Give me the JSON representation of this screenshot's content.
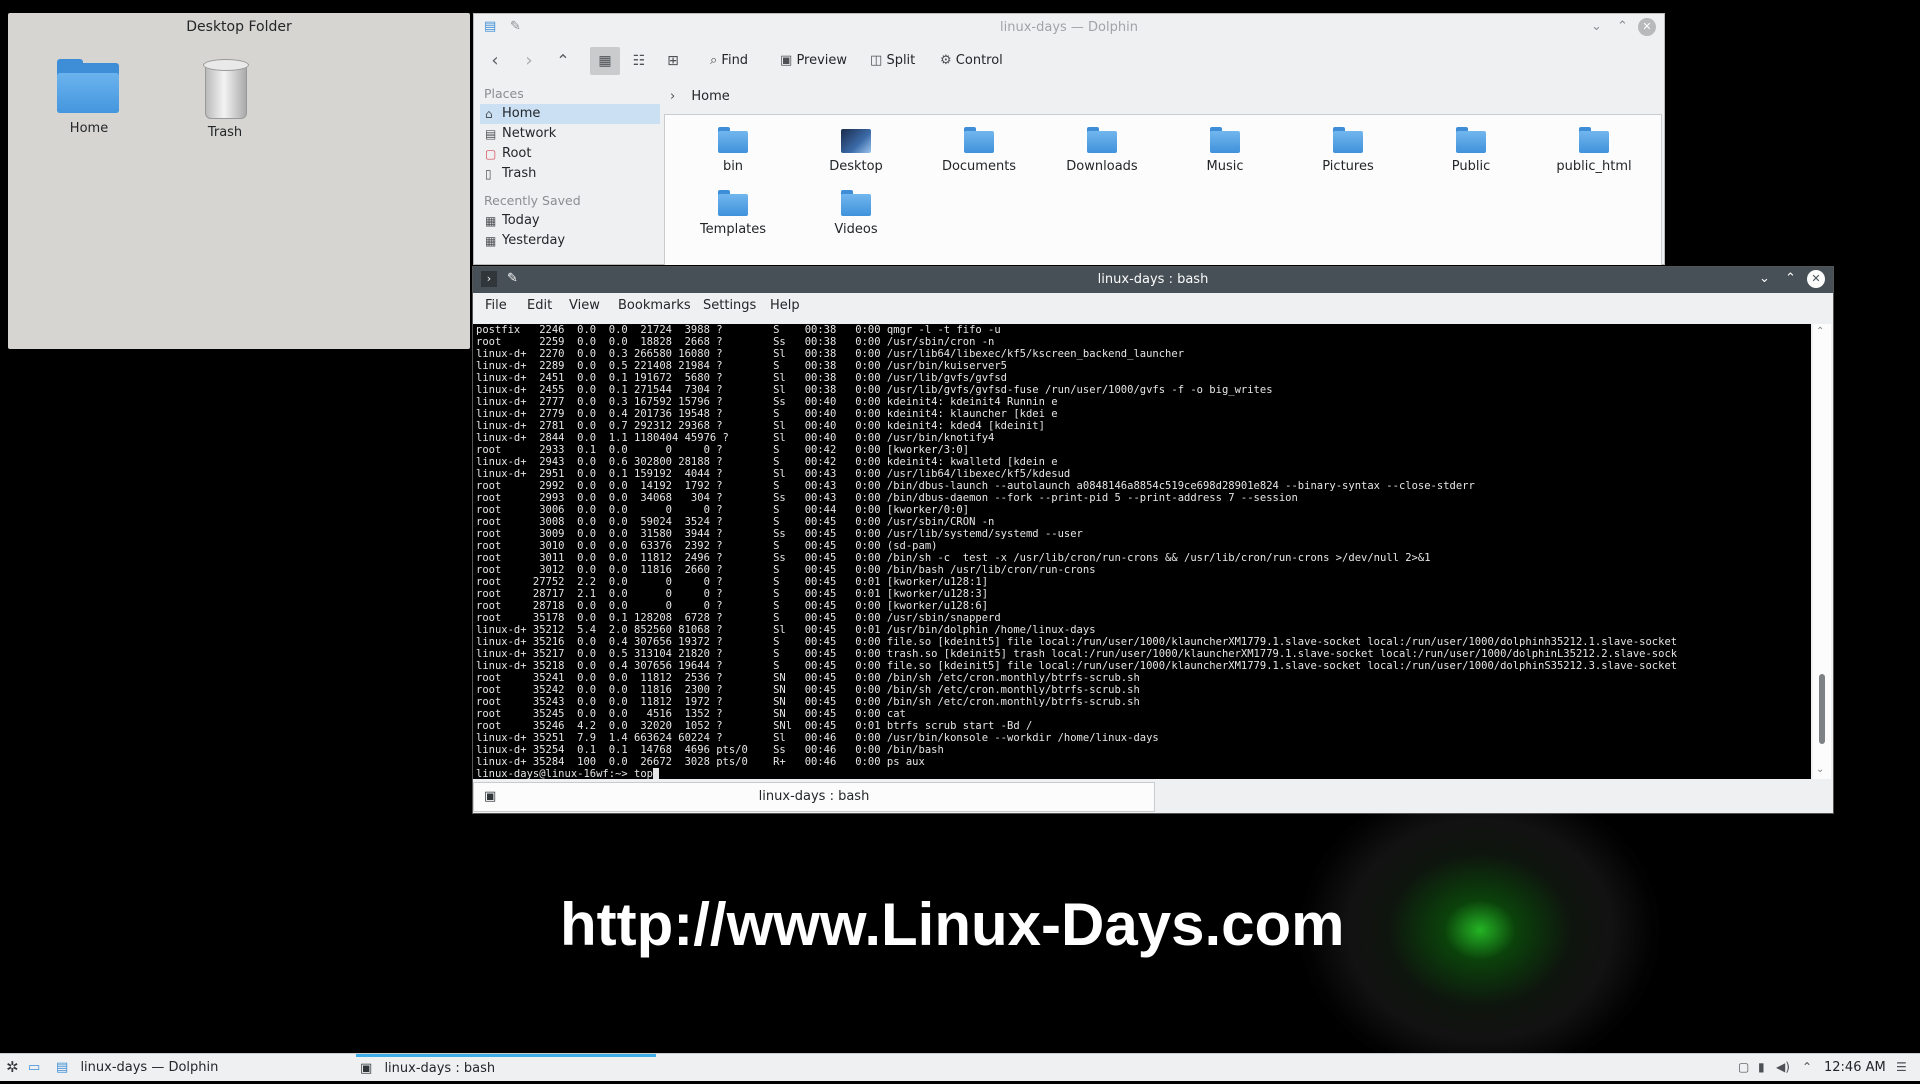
{
  "watermark": "http://www.Linux-Days.com",
  "desktop_folder": {
    "title": "Desktop Folder",
    "icons": [
      {
        "label": "Home"
      },
      {
        "label": "Trash"
      }
    ]
  },
  "dolphin": {
    "title": "linux-days — Dolphin",
    "toolbar": {
      "find": "Find",
      "preview": "Preview",
      "split": "Split",
      "control": "Control"
    },
    "places": {
      "section_places": "Places",
      "items": [
        {
          "label": "Home",
          "icon": "home-icon",
          "selected": true
        },
        {
          "label": "Network",
          "icon": "network-icon"
        },
        {
          "label": "Root",
          "icon": "root-folder-icon"
        },
        {
          "label": "Trash",
          "icon": "trash-icon"
        }
      ],
      "section_recent": "Recently Saved",
      "recent": [
        {
          "label": "Today",
          "icon": "calendar-icon"
        },
        {
          "label": "Yesterday",
          "icon": "calendar-icon"
        }
      ]
    },
    "breadcrumb": "Home",
    "files": [
      {
        "label": "bin"
      },
      {
        "label": "Desktop"
      },
      {
        "label": "Documents"
      },
      {
        "label": "Downloads"
      },
      {
        "label": "Music"
      },
      {
        "label": "Pictures"
      },
      {
        "label": "Public"
      },
      {
        "label": "public_html"
      },
      {
        "label": "Templates"
      },
      {
        "label": "Videos"
      }
    ]
  },
  "konsole": {
    "title": "linux-days : bash",
    "menu": [
      "File",
      "Edit",
      "View",
      "Bookmarks",
      "Settings",
      "Help"
    ],
    "tab_label": "linux-days : bash",
    "output": "postfix   2246  0.0  0.0  21724  3988 ?        S    00:38   0:00 qmgr -l -t fifo -u\nroot      2259  0.0  0.0  18828  2668 ?        Ss   00:38   0:00 /usr/sbin/cron -n\nlinux-d+  2270  0.0  0.3 266580 16080 ?        Sl   00:38   0:00 /usr/lib64/libexec/kf5/kscreen_backend_launcher\nlinux-d+  2289  0.0  0.5 221408 21984 ?        S    00:38   0:00 /usr/bin/kuiserver5\nlinux-d+  2451  0.0  0.1 191672  5680 ?        Sl   00:38   0:00 /usr/lib/gvfs/gvfsd\nlinux-d+  2455  0.0  0.1 271544  7304 ?        Sl   00:38   0:00 /usr/lib/gvfs/gvfsd-fuse /run/user/1000/gvfs -f -o big_writes\nlinux-d+  2777  0.0  0.3 167592 15796 ?        Ss   00:40   0:00 kdeinit4: kdeinit4 Runnin e\nlinux-d+  2779  0.0  0.4 201736 19548 ?        S    00:40   0:00 kdeinit4: klauncher [kdei e\nlinux-d+  2781  0.0  0.7 292312 29368 ?        Sl   00:40   0:00 kdeinit4: kded4 [kdeinit]\nlinux-d+  2844  0.0  1.1 1180404 45976 ?       Sl   00:40   0:00 /usr/bin/knotify4\nroot      2933  0.1  0.0      0     0 ?        S    00:42   0:00 [kworker/3:0]\nlinux-d+  2943  0.0  0.6 302800 28188 ?        S    00:42   0:00 kdeinit4: kwalletd [kdein e\nlinux-d+  2951  0.0  0.1 159192  4044 ?        Sl   00:43   0:00 /usr/lib64/libexec/kf5/kdesud\nroot      2992  0.0  0.0  14192  1792 ?        S    00:43   0:00 /bin/dbus-launch --autolaunch a0848146a8854c519ce698d28901e824 --binary-syntax --close-stderr\nroot      2993  0.0  0.0  34068   304 ?        Ss   00:43   0:00 /bin/dbus-daemon --fork --print-pid 5 --print-address 7 --session\nroot      3006  0.0  0.0      0     0 ?        S    00:44   0:00 [kworker/0:0]\nroot      3008  0.0  0.0  59024  3524 ?        S    00:45   0:00 /usr/sbin/CRON -n\nroot      3009  0.0  0.0  31580  3944 ?        Ss   00:45   0:00 /usr/lib/systemd/systemd --user\nroot      3010  0.0  0.0  63376  2392 ?        S    00:45   0:00 (sd-pam)\nroot      3011  0.0  0.0  11812  2496 ?        Ss   00:45   0:00 /bin/sh -c  test -x /usr/lib/cron/run-crons && /usr/lib/cron/run-crons >/dev/null 2>&1\nroot      3012  0.0  0.0  11816  2660 ?        S    00:45   0:00 /bin/bash /usr/lib/cron/run-crons\nroot     27752  2.2  0.0      0     0 ?        S    00:45   0:01 [kworker/u128:1]\nroot     28717  2.1  0.0      0     0 ?        S    00:45   0:01 [kworker/u128:3]\nroot     28718  0.0  0.0      0     0 ?        S    00:45   0:00 [kworker/u128:6]\nroot     35178  0.0  0.1 128208  6728 ?        S    00:45   0:00 /usr/sbin/snapperd\nlinux-d+ 35212  5.4  2.0 852560 81068 ?        Sl   00:45   0:01 /usr/bin/dolphin /home/linux-days\nlinux-d+ 35216  0.0  0.4 307656 19372 ?        S    00:45   0:00 file.so [kdeinit5] file local:/run/user/1000/klauncherXM1779.1.slave-socket local:/run/user/1000/dolphinh35212.1.slave-socket\nlinux-d+ 35217  0.0  0.5 313104 21820 ?        S    00:45   0:00 trash.so [kdeinit5] trash local:/run/user/1000/klauncherXM1779.1.slave-socket local:/run/user/1000/dolphinL35212.2.slave-sock\nlinux-d+ 35218  0.0  0.4 307656 19644 ?        S    00:45   0:00 file.so [kdeinit5] file local:/run/user/1000/klauncherXM1779.1.slave-socket local:/run/user/1000/dolphinS35212.3.slave-socket\nroot     35241  0.0  0.0  11812  2536 ?        SN   00:45   0:00 /bin/sh /etc/cron.monthly/btrfs-scrub.sh\nroot     35242  0.0  0.0  11816  2300 ?        SN   00:45   0:00 /bin/sh /etc/cron.monthly/btrfs-scrub.sh\nroot     35243  0.0  0.0  11812  1972 ?        SN   00:45   0:00 /bin/sh /etc/cron.monthly/btrfs-scrub.sh\nroot     35245  0.0  0.0   4516  1352 ?        SN   00:45   0:00 cat\nroot     35246  4.2  0.0  32020  1052 ?        SNl  00:45   0:01 btrfs scrub start -Bd /\nlinux-d+ 35251  7.9  1.4 663624 60224 ?        Sl   00:46   0:00 /usr/bin/konsole --workdir /home/linux-days\nlinux-d+ 35254  0.1  0.1  14768  4696 pts/0    Ss   00:46   0:00 /bin/bash\nlinux-d+ 35284  100  0.0  26672  3028 pts/0    R+   00:46   0:00 ps aux",
    "prompt": "linux-days@linux-16wf:~> top"
  },
  "taskbar": {
    "tasks": [
      {
        "label": "linux-days — Dolphin",
        "icon": "dolphin-icon"
      },
      {
        "label": "linux-days : bash",
        "icon": "konsole-icon",
        "active": true
      }
    ],
    "clock": "12:46 AM"
  }
}
